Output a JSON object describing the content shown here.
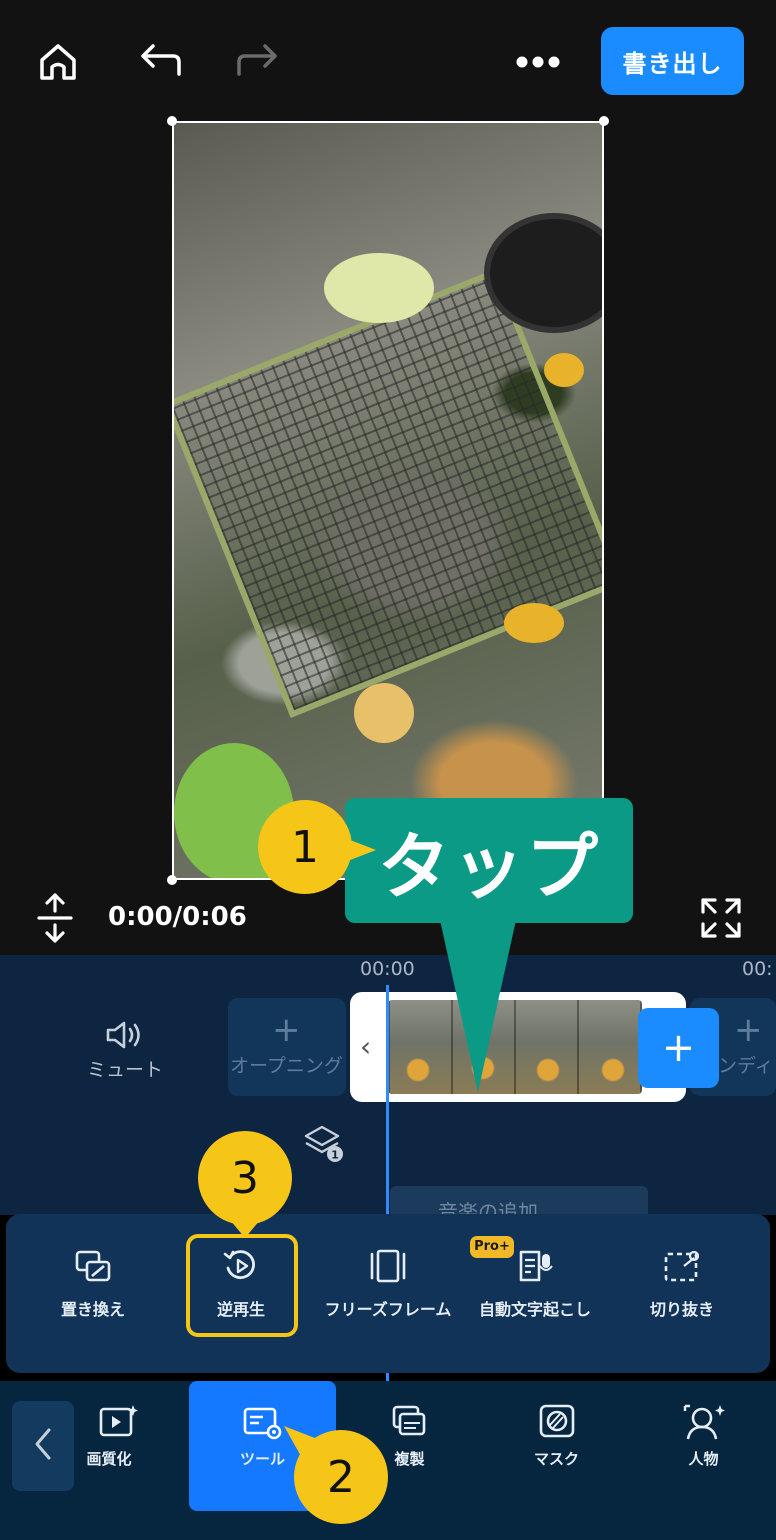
{
  "top_bar": {
    "export_label": "書き出し"
  },
  "player": {
    "time": "0:00/0:06"
  },
  "timeline": {
    "ruler": [
      "00:00",
      "00:"
    ],
    "mute_label": "ミュート",
    "opening_label": "オープニング",
    "ending_label": "ンディン",
    "layer_count": "1",
    "music_label": "音楽の追加"
  },
  "tools": [
    {
      "label": "置き換え",
      "icon": "replace-icon"
    },
    {
      "label": "逆再生",
      "icon": "reverse-play-icon"
    },
    {
      "label": "フリーズフレーム",
      "icon": "freeze-frame-icon"
    },
    {
      "label": "自動文字起こし",
      "icon": "auto-caption-icon",
      "badge": "Pro+"
    },
    {
      "label": "切り抜き",
      "icon": "cutout-icon"
    }
  ],
  "bottom_tabs": [
    {
      "label": "画質化",
      "icon": "video-enhance-icon"
    },
    {
      "label": "ツール",
      "icon": "tools-icon",
      "active": true
    },
    {
      "label": "複製",
      "icon": "duplicate-icon"
    },
    {
      "label": "マスク",
      "icon": "mask-icon"
    },
    {
      "label": "人物",
      "icon": "person-icon"
    }
  ],
  "annotations": {
    "callout_text": "タップ",
    "step1": "1",
    "step2": "2",
    "step3": "3"
  },
  "colors": {
    "accent": "#1a8cff",
    "callout": "#0b9a85",
    "step_marker": "#f5c518",
    "panel": "#103357",
    "timeline_bg": "#0d2540"
  }
}
